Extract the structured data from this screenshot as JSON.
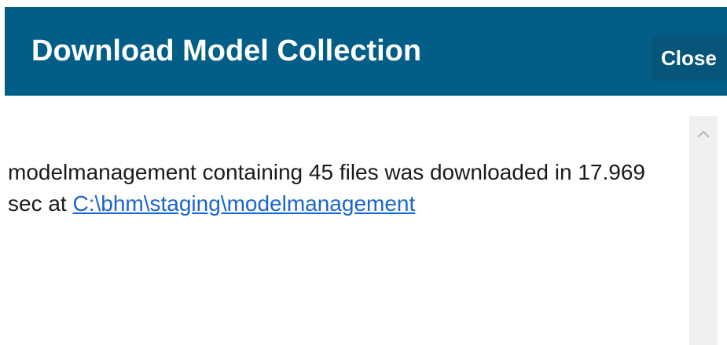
{
  "dialog": {
    "title": "Download Model Collection",
    "close_label": "Close"
  },
  "message": {
    "text_before_link": "modelmanagement containing 45 files was downloaded in 17.969 sec at ",
    "link_text": "C:\\bhm\\staging\\modelmanagement"
  },
  "scrollbar": {
    "up_icon": "chevron-up-icon"
  },
  "colors": {
    "header_bg": "#035e87",
    "close_bg": "#07557a",
    "link": "#1a66c9",
    "scrollbar_track": "#f0f0f0"
  }
}
